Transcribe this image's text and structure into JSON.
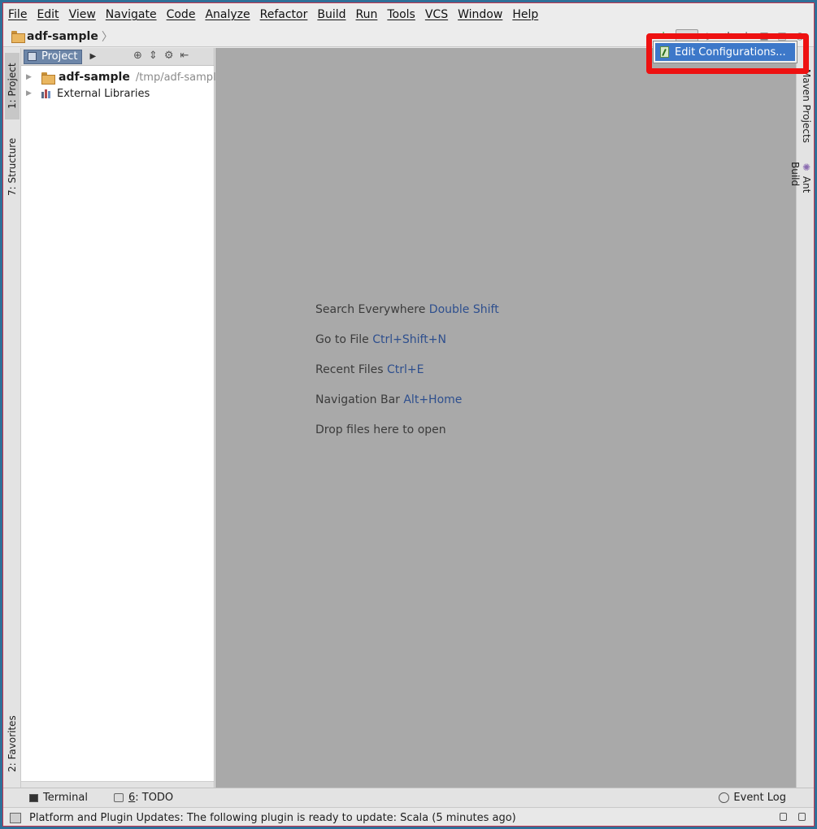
{
  "menubar": {
    "items": [
      "File",
      "Edit",
      "View",
      "Navigate",
      "Code",
      "Analyze",
      "Refactor",
      "Build",
      "Run",
      "Tools",
      "VCS",
      "Window",
      "Help"
    ]
  },
  "navbar": {
    "project": "adf-sample"
  },
  "left_strip": {
    "tab1": "1: Project",
    "tab2": "7: Structure",
    "tab3": "2: Favorites"
  },
  "right_strip": {
    "tab1": "Maven Projects",
    "tab2": "Ant Build"
  },
  "project_panel": {
    "tab_label": "Project",
    "tree": [
      {
        "name": "adf-sample",
        "path": "/tmp/adf-sample"
      },
      {
        "name": "External Libraries"
      }
    ]
  },
  "editor": {
    "hints": [
      {
        "text": "Search Everywhere",
        "key": "Double Shift"
      },
      {
        "text": "Go to File",
        "key": "Ctrl+Shift+N"
      },
      {
        "text": "Recent Files",
        "key": "Ctrl+E"
      },
      {
        "text": "Navigation Bar",
        "key": "Alt+Home"
      },
      {
        "text": "Drop files here to open",
        "key": ""
      }
    ]
  },
  "popup": {
    "item": "Edit Configurations..."
  },
  "bottom_bar": {
    "terminal": "Terminal",
    "todo_num": "6",
    "todo_label": ": TODO",
    "event_log": "Event Log"
  },
  "status": {
    "message": "Platform and Plugin Updates: The following plugin is ready to update: Scala (5 minutes ago)"
  },
  "colors": {
    "accent": "#3d78c9",
    "highlight": "#ee1111",
    "editor_bg": "#a9a9a9",
    "shortcut": "#2e4f8e"
  }
}
